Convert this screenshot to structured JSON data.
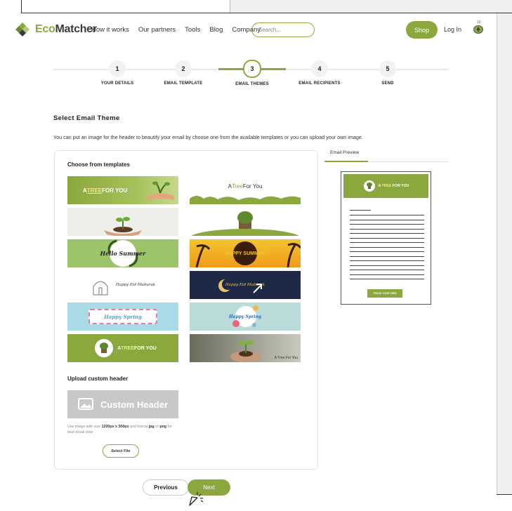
{
  "header": {
    "logo_eco": "Eco",
    "logo_matcher": "Matcher",
    "nav": [
      "How it works",
      "Our partners",
      "Tools",
      "Blog",
      "Company"
    ],
    "search_placeholder": "Search...",
    "shop_label": "Shop",
    "login_label": "Log In",
    "cart_count": "10"
  },
  "stepper": {
    "steps": [
      {
        "number": "1",
        "label": "YOUR DETAILS"
      },
      {
        "number": "2",
        "label": "EMAIL TEMPLATE"
      },
      {
        "number": "3",
        "label": "EMAIL THEMES"
      },
      {
        "number": "4",
        "label": "EMAIL RECIPIENTS"
      },
      {
        "number": "5",
        "label": "SEND"
      }
    ],
    "active_step": 3
  },
  "main": {
    "title": "Select Email Theme",
    "description": "You can put an image for the header to beautify your email by choose one from the available templates or you can upload your own image."
  },
  "templates": {
    "title": "Choose from templates",
    "items": [
      {
        "text_a": "A ",
        "text_b": "TREE",
        "text_c": " FOR YOU"
      },
      {
        "text_a": "A ",
        "text_b": "Tree",
        "text_c": " For You"
      },
      {
        "text": ""
      },
      {
        "text": ""
      },
      {
        "text": "Hello Summer"
      },
      {
        "text": "HAPPY SUMMER"
      },
      {
        "text": "Happy Eid Mubarak"
      },
      {
        "text": "Happy Eid Mubarak"
      },
      {
        "text": "Happy Spring"
      },
      {
        "text": "Happy Spring"
      },
      {
        "text_a": "A ",
        "text_b": "TREE",
        "text_c": " FOR YOU"
      },
      {
        "text": "A Tree For You"
      }
    ],
    "accent": "#8aa83e"
  },
  "upload": {
    "title": "Upload custom header",
    "custom_header_label": "Custom Header",
    "hint_a": "Use image with size ",
    "hint_size": "1200px x 300px",
    "hint_b": " and format ",
    "hint_jpg": "jpg",
    "hint_c": " or ",
    "hint_png": "png",
    "hint_d": " for best email view",
    "select_file": "Select File"
  },
  "preview": {
    "tab_label": "Email Preview",
    "header_text_a": "A ",
    "header_text_b": "TREE",
    "header_text_c": " FOR YOU",
    "button_label": "TRACK YOUR TREE"
  },
  "footer": {
    "previous": "Previous",
    "next": "Next"
  }
}
